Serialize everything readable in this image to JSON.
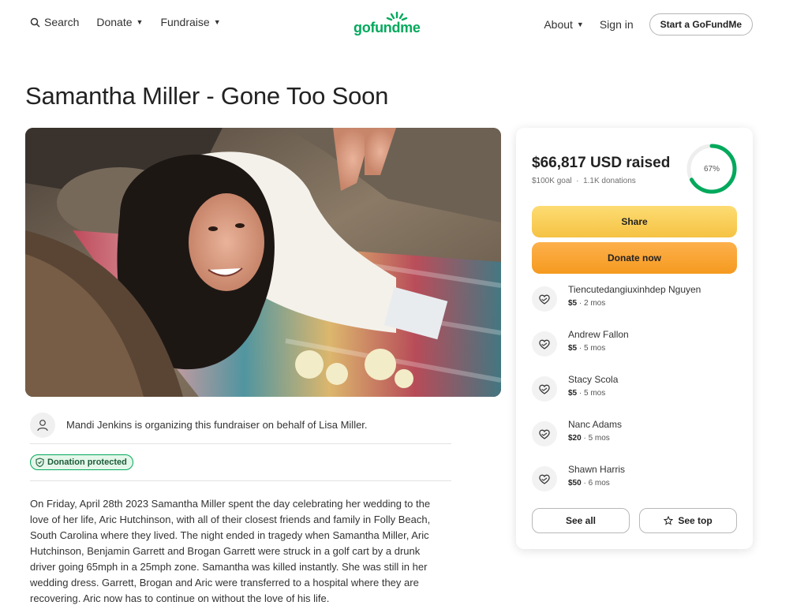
{
  "header": {
    "search_label": "Search",
    "donate_label": "Donate",
    "fundraise_label": "Fundraise",
    "logo_text": "gofundme",
    "about_label": "About",
    "signin_label": "Sign in",
    "start_label": "Start a GoFundMe"
  },
  "campaign": {
    "title": "Samantha Miller - Gone Too Soon",
    "organizer_text": "Mandi Jenkins is organizing this fundraiser on behalf of Lisa Miller.",
    "protected_label": "Donation protected",
    "story": "On Friday, April 28th 2023 Samantha Miller spent the day celebrating her wedding to the love of her life, Aric Hutchinson, with all of their closest friends and family in Folly Beach, South Carolina where they lived. The night ended in tragedy when Samantha Miller, Aric Hutchinson, Benjamin Garrett and Brogan Garrett were struck in a golf cart by a drunk driver going 65mph in a 25mph zone. Samantha was killed instantly. She was still in her wedding dress. Garrett, Brogan and Aric were transferred to a hospital where they are recovering. Aric now has to continue on without the love of his life."
  },
  "sidebar": {
    "raised": "$66,817 USD raised",
    "goal": "$100K goal",
    "donations": "1.1K donations",
    "progress_label": "67%",
    "progress_fraction": 0.67,
    "share_label": "Share",
    "donate_label": "Donate now",
    "see_all_label": "See all",
    "see_top_label": "See top",
    "donors": [
      {
        "name": "Tiencutedangiuxinhdep Nguyen",
        "amount": "$5",
        "time": " · 2 mos"
      },
      {
        "name": "Andrew Fallon",
        "amount": "$5",
        "time": " · 5 mos"
      },
      {
        "name": "Stacy Scola",
        "amount": "$5",
        "time": " · 5 mos"
      },
      {
        "name": "Nanc Adams",
        "amount": "$20",
        "time": " · 5 mos"
      },
      {
        "name": "Shawn Harris",
        "amount": "$50",
        "time": " · 6 mos"
      }
    ]
  },
  "colors": {
    "brand": "#02a95c",
    "share": "#f8cb52",
    "donate": "#f7a02f"
  }
}
